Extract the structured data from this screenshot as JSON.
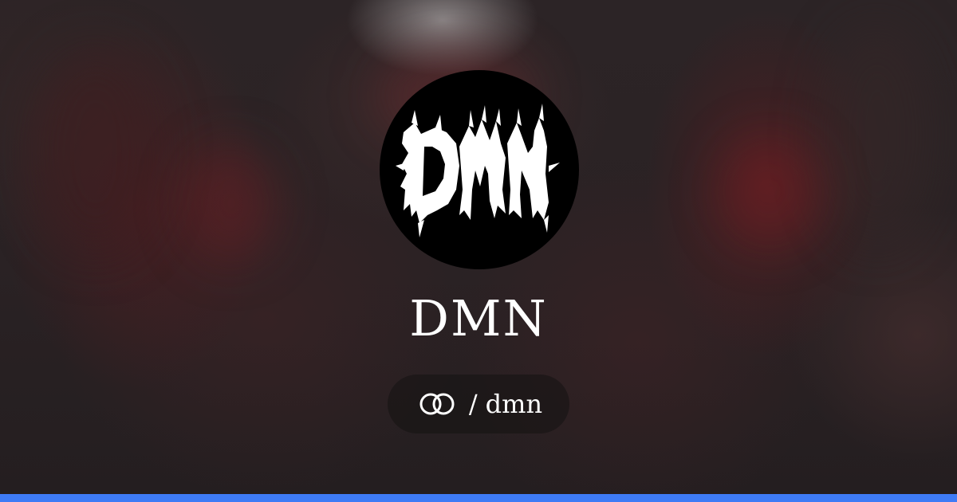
{
  "profile": {
    "name": "DMN",
    "handle_separator": "/",
    "handle": "dmn",
    "logo_text": "DMN"
  },
  "icons": {
    "link": "link-rings-icon"
  },
  "colors": {
    "bottom_bar": "#3e7bf6",
    "avatar_bg": "#000000",
    "text": "#ffffff"
  }
}
